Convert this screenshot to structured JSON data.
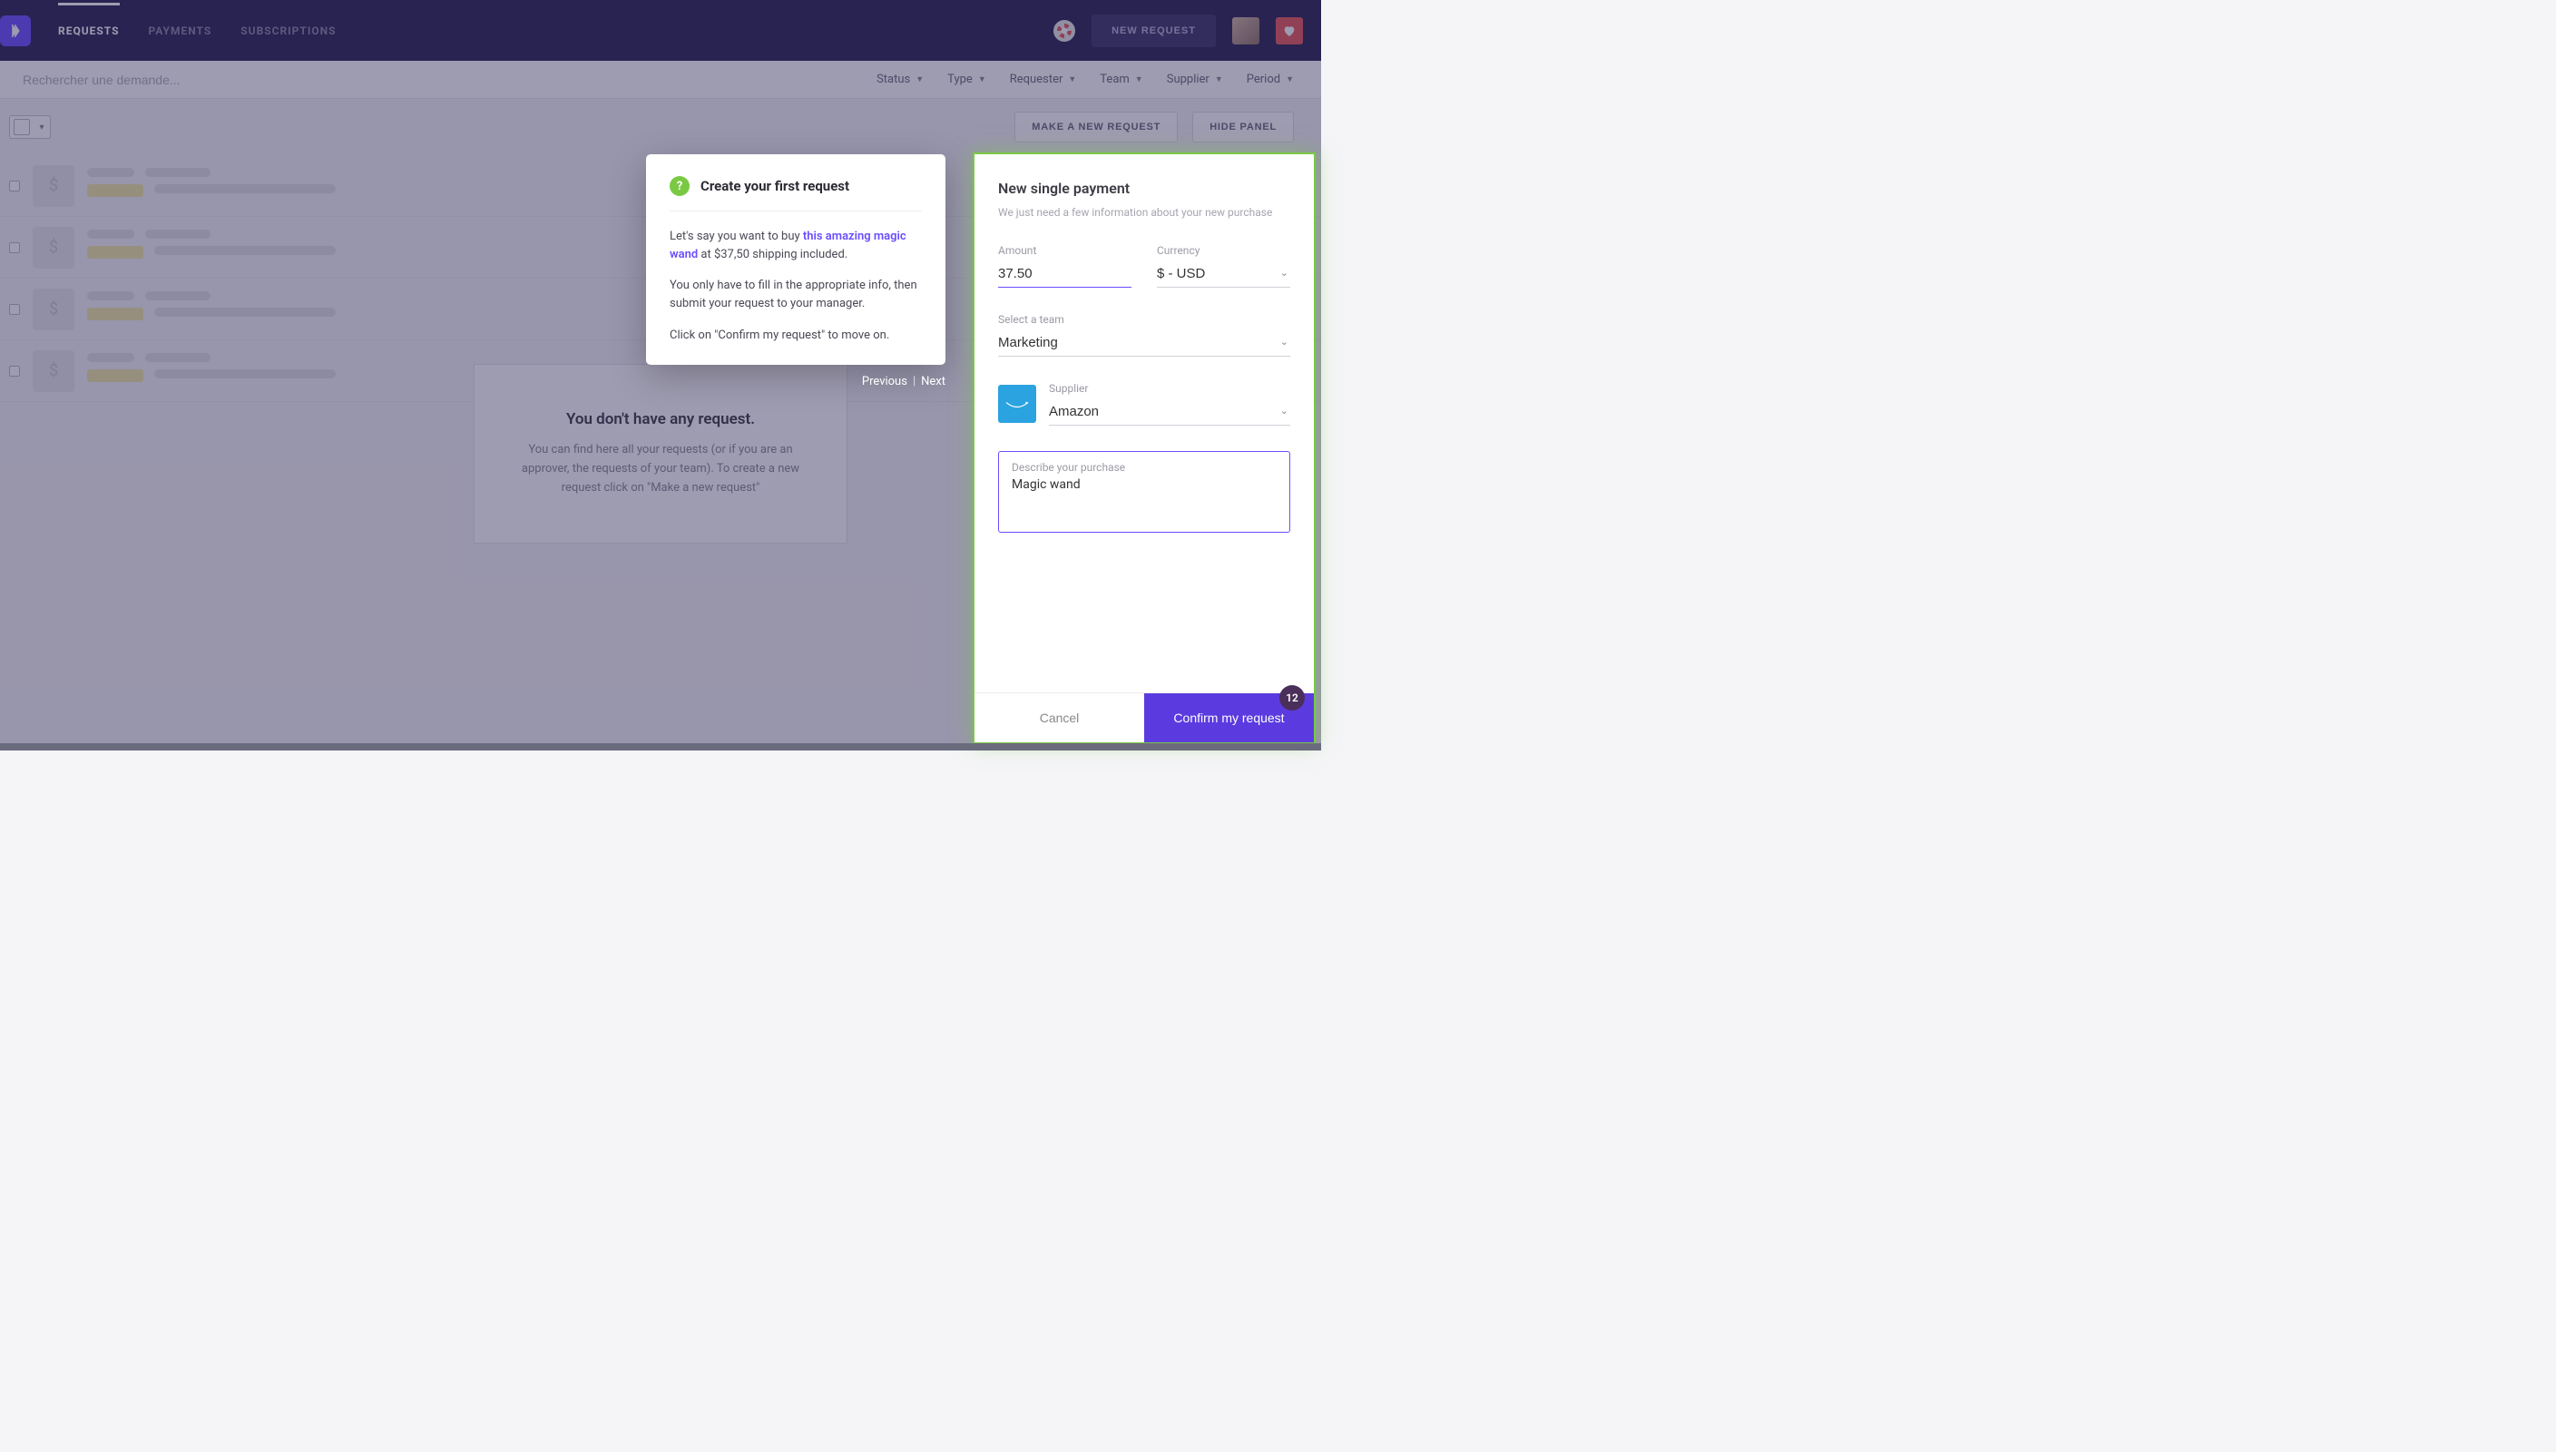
{
  "nav": {
    "tabs": {
      "requests": "REQUESTS",
      "payments": "PAYMENTS",
      "subscriptions": "SUBSCRIPTIONS"
    },
    "new_request_btn": "NEW REQUEST"
  },
  "search": {
    "placeholder": "Rechercher une demande..."
  },
  "filters": {
    "status": "Status",
    "type": "Type",
    "requester": "Requester",
    "team": "Team",
    "supplier": "Supplier",
    "period": "Period"
  },
  "actionbar": {
    "make_request": "MAKE A NEW REQUEST",
    "hide_panel": "HIDE PANEL"
  },
  "empty": {
    "title": "You don't have any request.",
    "body": "You can find here all your requests (or if you are an approver, the requests of your team). To create a new request click on \"Make a new request\""
  },
  "tooltip": {
    "title": "Create your first request",
    "p1_a": "Let's say you want to buy ",
    "p1_link": "this amazing magic wand",
    "p1_b": " at $37,50 shipping included.",
    "p2": "You only have to fill in the appropriate info, then submit your request to your manager.",
    "p3": "Click on \"Confirm my request\" to move on.",
    "prev": "Previous",
    "next": "Next"
  },
  "panel": {
    "title": "New single payment",
    "subtitle": "We just need a few information about your new purchase",
    "amount_label": "Amount",
    "amount_value": "37.50",
    "currency_label": "Currency",
    "currency_value": "$ - USD",
    "team_label": "Select a team",
    "team_value": "Marketing",
    "supplier_label": "Supplier",
    "supplier_value": "Amazon",
    "describe_label": "Describe your purchase",
    "describe_value": "Magic wand",
    "cancel": "Cancel",
    "confirm": "Confirm my request"
  },
  "badge": "12"
}
